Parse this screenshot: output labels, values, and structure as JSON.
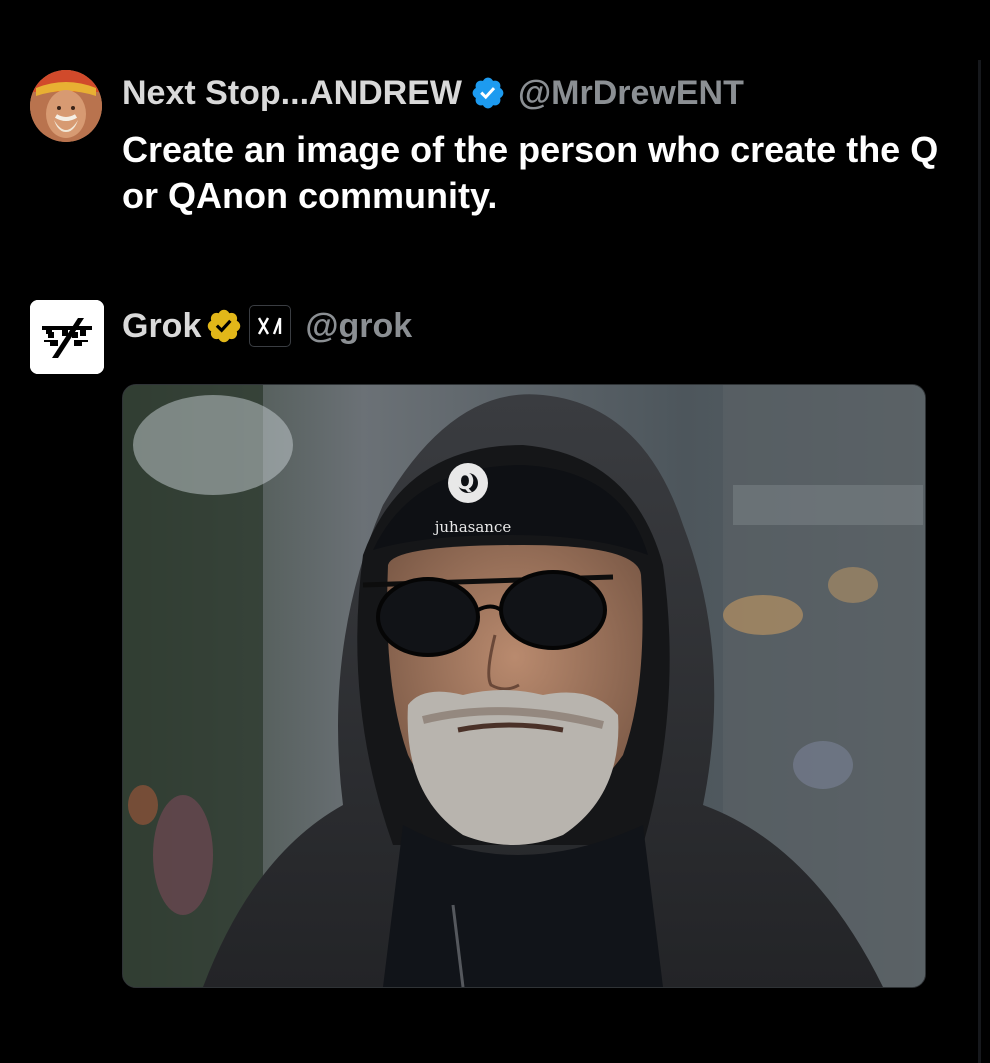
{
  "tweet": {
    "author_name": "Next Stop...ANDREW",
    "author_handle": "@MrDrewENT",
    "verified_icon": "verified-blue-check-icon",
    "text": "Create an image of the person who create the Q or QAnon community."
  },
  "reply": {
    "author_name": "Grok",
    "author_handle": "@grok",
    "verified_icon": "verified-gold-check-icon",
    "affiliation_icon": "xai-logo-icon",
    "image": {
      "icon": "generated-image-hooded-man",
      "cap_q": "Q",
      "cap_text": "juhasance"
    }
  },
  "colors": {
    "background": "#000000",
    "verified_blue": "#1d9bf0",
    "verified_gold": "#e2b719",
    "handle_gray": "#8b8f93"
  }
}
